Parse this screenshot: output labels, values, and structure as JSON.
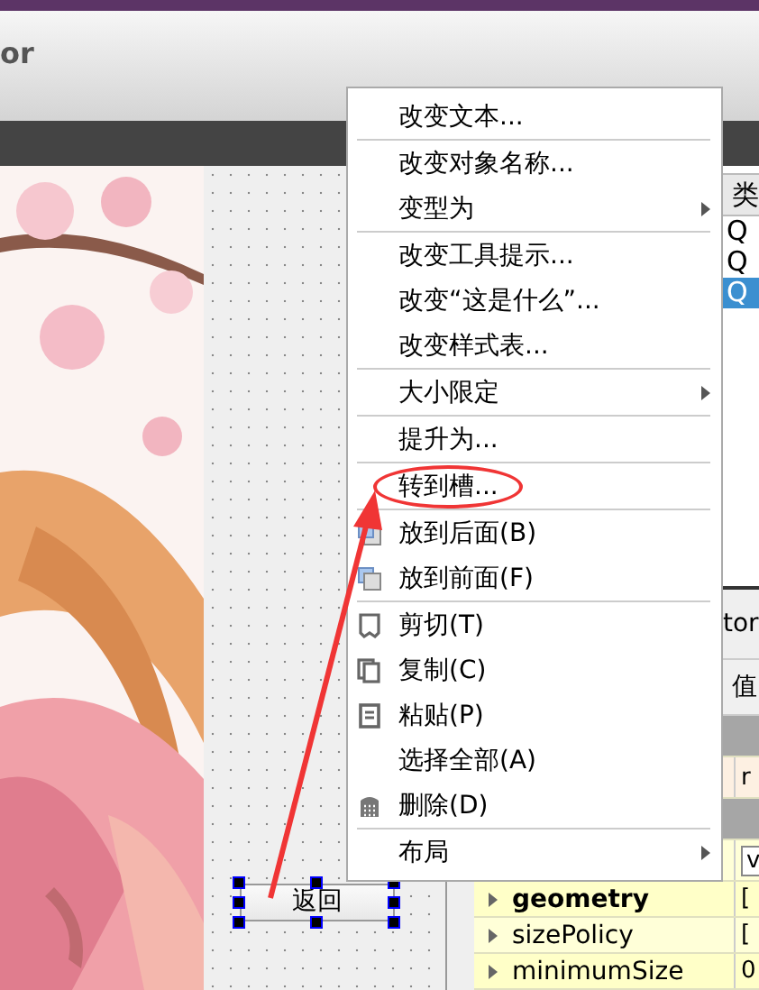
{
  "window": {
    "title": "or"
  },
  "form": {
    "button": {
      "label": "返回",
      "selected": true
    }
  },
  "object_inspector": {
    "column_header": "类",
    "rows": [
      {
        "text": "Q",
        "selected": false
      },
      {
        "text": "Q",
        "selected": false
      },
      {
        "text": "Q",
        "selected": true
      }
    ]
  },
  "property_editor": {
    "title": "tor",
    "value_header": "值",
    "rows": [
      {
        "kind": "group"
      },
      {
        "kind": "property",
        "value": "r",
        "color": "#fdf0e2"
      },
      {
        "kind": "group"
      },
      {
        "kind": "combo",
        "value": "v",
        "color": "#ffffd8"
      },
      {
        "kind": "property",
        "name": "geometry",
        "bold": true,
        "expandable": true,
        "value": "[",
        "color": "#ffffc8"
      },
      {
        "kind": "property",
        "name": "sizePolicy",
        "bold": false,
        "expandable": true,
        "value": "[",
        "color": "#ffffd8"
      },
      {
        "kind": "property",
        "name": "minimumSize",
        "bold": false,
        "expandable": true,
        "value": "0",
        "color": "#ffffc8"
      }
    ]
  },
  "context_menu": {
    "items": [
      {
        "kind": "action",
        "label": "改变文本...",
        "circled": false
      },
      {
        "kind": "separator"
      },
      {
        "kind": "action",
        "label": "改变对象名称...",
        "circled": false
      },
      {
        "kind": "submenu",
        "label": "变型为"
      },
      {
        "kind": "separator"
      },
      {
        "kind": "action",
        "label": "改变工具提示...",
        "circled": false
      },
      {
        "kind": "action",
        "label": "改变“这是什么”...",
        "circled": false
      },
      {
        "kind": "action",
        "label": "改变样式表...",
        "circled": false
      },
      {
        "kind": "separator"
      },
      {
        "kind": "submenu",
        "label": "大小限定"
      },
      {
        "kind": "separator"
      },
      {
        "kind": "action",
        "label": "提升为...",
        "circled": false
      },
      {
        "kind": "separator"
      },
      {
        "kind": "action",
        "label": "转到槽...",
        "circled": true
      },
      {
        "kind": "separator"
      },
      {
        "kind": "action",
        "label": "放到后面(B)",
        "circled": false
      },
      {
        "kind": "action",
        "label": "放到前面(F)",
        "circled": false
      },
      {
        "kind": "separator"
      },
      {
        "kind": "action",
        "label": "剪切(T)",
        "circled": false
      },
      {
        "kind": "action",
        "label": "复制(C)",
        "circled": false
      },
      {
        "kind": "action",
        "label": "粘贴(P)",
        "circled": false
      },
      {
        "kind": "action",
        "label": "选择全部(A)",
        "circled": false
      },
      {
        "kind": "action",
        "label": "删除(D)",
        "circled": false
      },
      {
        "kind": "separator"
      },
      {
        "kind": "submenu",
        "label": "布局"
      }
    ]
  }
}
